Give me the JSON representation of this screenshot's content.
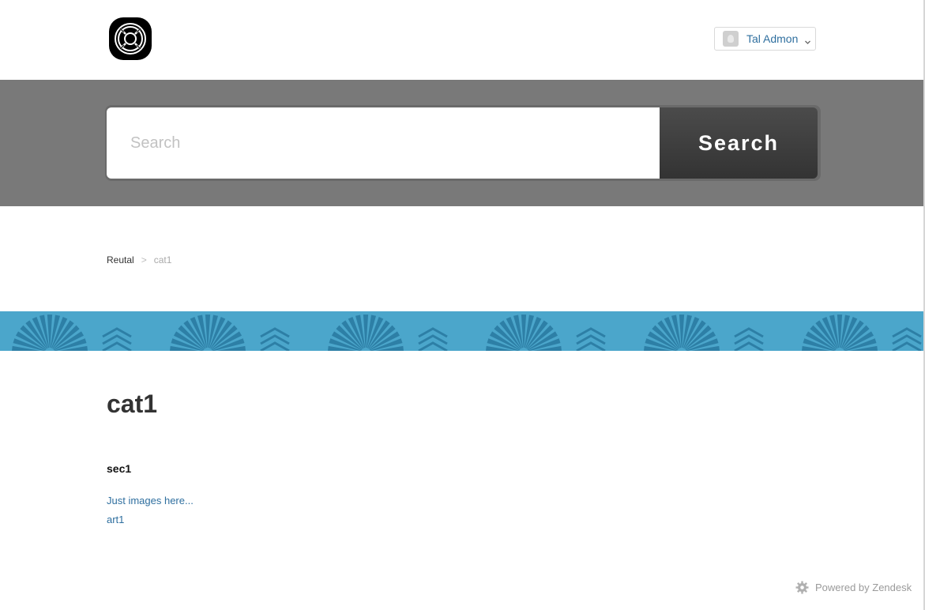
{
  "header": {
    "logo_icon": "lifebuoy-icon",
    "user_name": "Tal Admon",
    "user_avatar_icon": "user-avatar-icon",
    "user_menu_icon": "chevron-down-icon"
  },
  "search": {
    "placeholder": "Search",
    "value": "",
    "button_label": "Search"
  },
  "breadcrumbs": {
    "items": [
      "Reutal",
      "cat1"
    ],
    "separator": ">"
  },
  "category": {
    "title": "cat1",
    "sections": [
      {
        "title": "sec1",
        "articles": [
          "Just images here...",
          "art1"
        ]
      }
    ]
  },
  "footer": {
    "powered_by": "Powered by Zendesk",
    "icon": "zendesk-gear-icon"
  },
  "colors": {
    "header_bg": "#ffffff",
    "search_band_bg": "#797979",
    "search_button_bg": "#3f3f3f",
    "pattern_strip_bg": "#4ba6cb",
    "pattern_shape": "#2d7fa6",
    "link": "#2f6f9f"
  }
}
